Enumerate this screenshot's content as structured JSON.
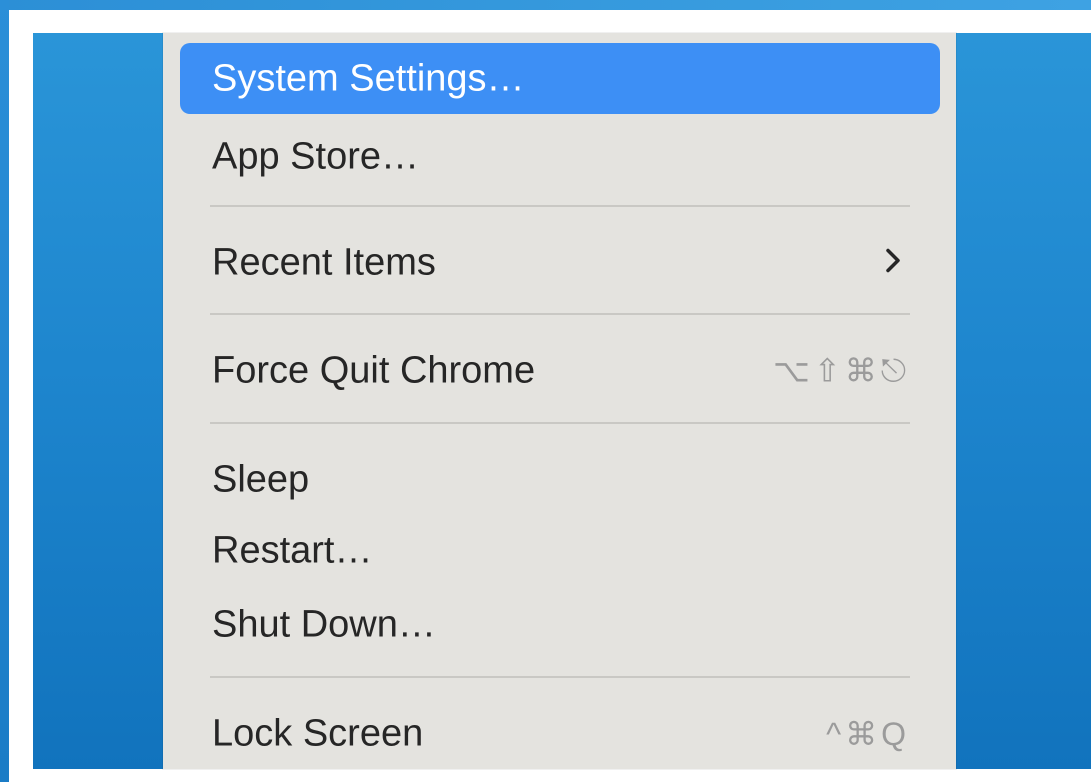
{
  "menu": {
    "items": [
      {
        "label": "System Settings…",
        "highlighted": true
      },
      {
        "label": "App Store…"
      },
      {
        "label": "Recent Items",
        "submenu_icon": "chevron-right-icon"
      },
      {
        "label": "Force Quit Chrome",
        "shortcut": "⌥⇧⌘⎋"
      },
      {
        "label": "Sleep"
      },
      {
        "label": "Restart…"
      },
      {
        "label": "Shut Down…"
      },
      {
        "label": "Lock Screen",
        "shortcut": "^⌘Q"
      }
    ]
  },
  "colors": {
    "highlight": "#3d8ff5",
    "menu_background": "#e4e3df",
    "desktop": "#1e86ce",
    "shortcut_text": "#9b9b9b"
  }
}
